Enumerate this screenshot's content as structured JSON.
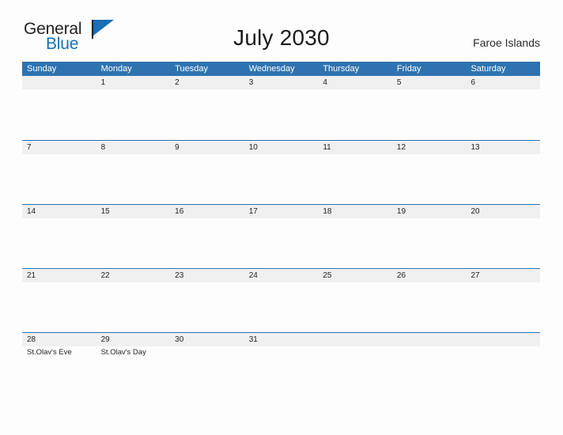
{
  "brand": {
    "name_part1": "General",
    "name_part2": "Blue",
    "flag_icon": "triangle-flag-icon",
    "primary_color": "#1a6fb5"
  },
  "header": {
    "title": "July 2030",
    "region": "Faroe Islands"
  },
  "calendar": {
    "header_bg": "#2e73b0",
    "date_band_bg": "#f0f0f0",
    "weekdays": [
      "Sunday",
      "Monday",
      "Tuesday",
      "Wednesday",
      "Thursday",
      "Friday",
      "Saturday"
    ],
    "weeks": [
      [
        {
          "day": "",
          "event": ""
        },
        {
          "day": "1",
          "event": ""
        },
        {
          "day": "2",
          "event": ""
        },
        {
          "day": "3",
          "event": ""
        },
        {
          "day": "4",
          "event": ""
        },
        {
          "day": "5",
          "event": ""
        },
        {
          "day": "6",
          "event": ""
        }
      ],
      [
        {
          "day": "7",
          "event": ""
        },
        {
          "day": "8",
          "event": ""
        },
        {
          "day": "9",
          "event": ""
        },
        {
          "day": "10",
          "event": ""
        },
        {
          "day": "11",
          "event": ""
        },
        {
          "day": "12",
          "event": ""
        },
        {
          "day": "13",
          "event": ""
        }
      ],
      [
        {
          "day": "14",
          "event": ""
        },
        {
          "day": "15",
          "event": ""
        },
        {
          "day": "16",
          "event": ""
        },
        {
          "day": "17",
          "event": ""
        },
        {
          "day": "18",
          "event": ""
        },
        {
          "day": "19",
          "event": ""
        },
        {
          "day": "20",
          "event": ""
        }
      ],
      [
        {
          "day": "21",
          "event": ""
        },
        {
          "day": "22",
          "event": ""
        },
        {
          "day": "23",
          "event": ""
        },
        {
          "day": "24",
          "event": ""
        },
        {
          "day": "25",
          "event": ""
        },
        {
          "day": "26",
          "event": ""
        },
        {
          "day": "27",
          "event": ""
        }
      ],
      [
        {
          "day": "28",
          "event": "St.Olav's Eve"
        },
        {
          "day": "29",
          "event": "St.Olav's Day"
        },
        {
          "day": "30",
          "event": ""
        },
        {
          "day": "31",
          "event": ""
        },
        {
          "day": "",
          "event": ""
        },
        {
          "day": "",
          "event": ""
        },
        {
          "day": "",
          "event": ""
        }
      ]
    ]
  }
}
